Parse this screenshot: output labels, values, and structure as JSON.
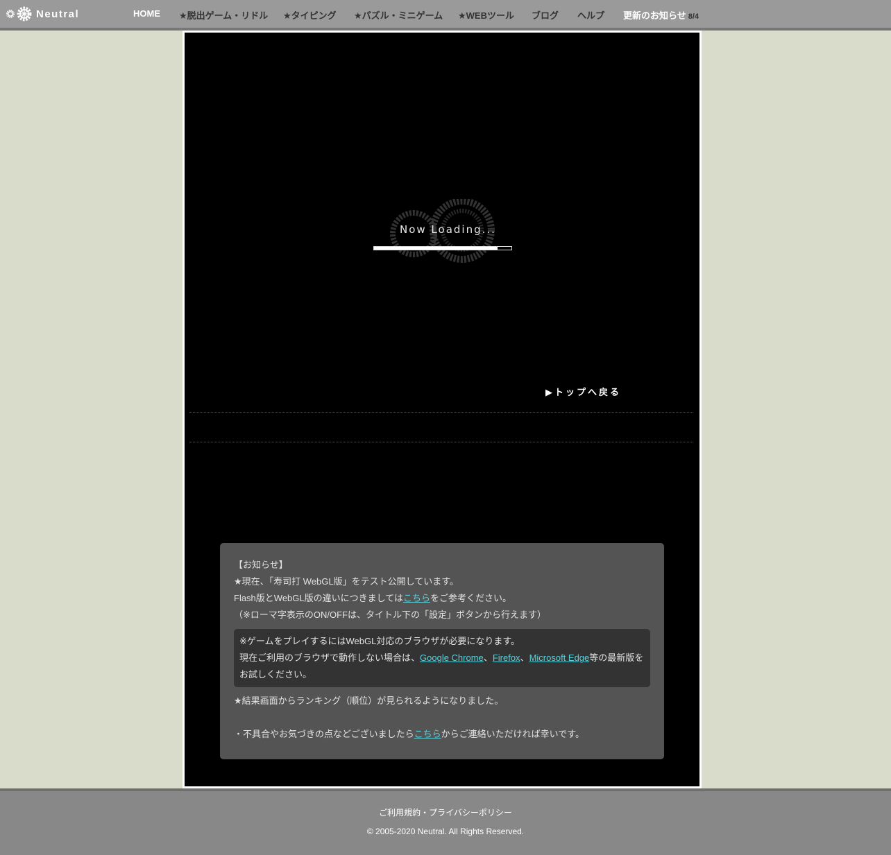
{
  "header": {
    "logo_text": "Neutral",
    "nav": [
      {
        "label": "HOME"
      },
      {
        "label": "★脱出ゲーム・リドル"
      },
      {
        "label": "★タイピング"
      },
      {
        "label": "★パズル・ミニゲーム"
      },
      {
        "label": "★WEBツール"
      },
      {
        "label": "ブログ"
      },
      {
        "label": "ヘルプ"
      }
    ],
    "news_label": "更新のお知らせ",
    "news_date": "8/4"
  },
  "game": {
    "loading_text": "Now Loading...",
    "progress": 0.9,
    "back_link": "▶トップへ戻る"
  },
  "notice": {
    "title": "【お知らせ】",
    "line1": "★現在、「寿司打 WebGL版」をテスト公開しています。",
    "line2_pre": "Flash版とWebGL版の違いにつきましては",
    "line2_link": "こちら",
    "line2_post": "をご参考ください。",
    "line3": "（※ローマ字表示のON/OFFは、タイトル下の「設定」ボタンから行えます）",
    "box_line1": "※ゲームをプレイするにはWebGL対応のブラウザが必要になります。",
    "box_line2_pre": "現在ご利用のブラウザで動作しない場合は、",
    "link_chrome": "Google Chrome",
    "sep1": "、",
    "link_firefox": "Firefox",
    "sep2": "、",
    "link_edge": "Microsoft Edge",
    "box_line2_post": "等の最新版をお試しください。",
    "line4": "★結果画面からランキング（順位）が見られるようになりました。",
    "line5_pre": "・不具合やお気づきの点などございましたら",
    "line5_link": "こちら",
    "line5_post": "からご連絡いただければ幸いです。"
  },
  "footer": {
    "links": "ご利用規約・プライバシーポリシー",
    "copyright": "© 2005-2020 Neutral. All Rights Reserved."
  }
}
